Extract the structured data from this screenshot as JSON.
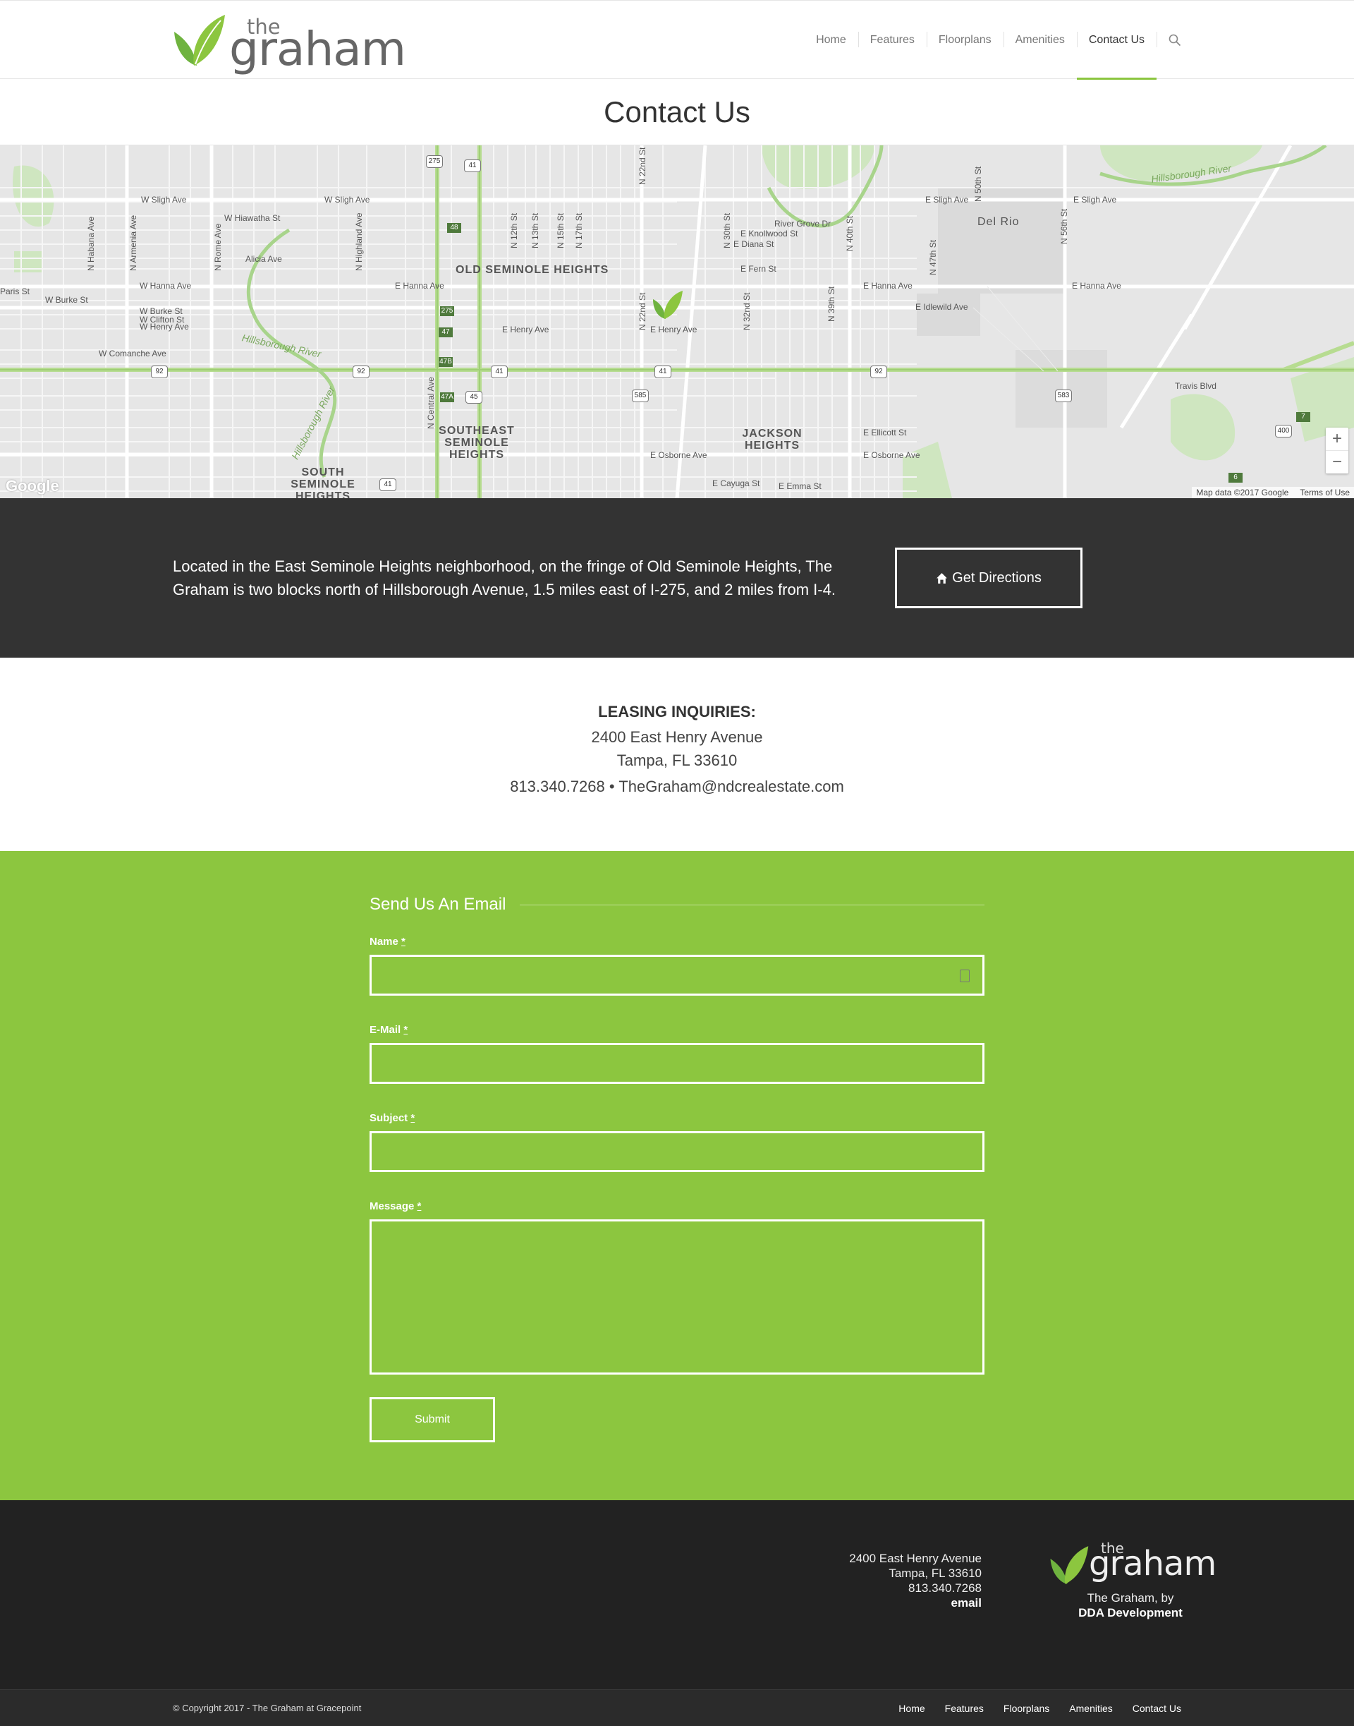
{
  "brand": {
    "the": "the",
    "name": "graham"
  },
  "nav": {
    "items": [
      "Home",
      "Features",
      "Floorplans",
      "Amenities",
      "Contact Us"
    ],
    "active": "Contact Us"
  },
  "page_title": "Contact Us",
  "map": {
    "neighborhoods": [
      "OLD SEMINOLE HEIGHTS",
      "SOUTHEAST SEMINOLE HEIGHTS",
      "JACKSON HEIGHTS",
      "SOUTH SEMINOLE HEIGHTS",
      "Del Rio"
    ],
    "streets": [
      "W Sligh Ave",
      "E Sligh Ave",
      "W Hiawatha St",
      "E Hanna Ave",
      "W Hanna Ave",
      "E Henry Ave",
      "W Henry Ave",
      "W Comanche Ave",
      "E Osborne Ave",
      "E Fern St",
      "E Idlewild Ave",
      "Travis Blvd",
      "River Grove Dr",
      "E Knollwood St",
      "E Diana St",
      "E Cayuga St",
      "E Emma St",
      "E Ellicott St",
      "W Burke St",
      "W Clifton St",
      "Alicia Ave",
      "Paris St"
    ],
    "vertical_streets": [
      "N 22nd St",
      "N 15th St",
      "N 17th St",
      "N 13th St",
      "N 12th St",
      "N 30th St",
      "N 40th St",
      "N 56th St",
      "N 47th St",
      "N 50th St",
      "N 39th St",
      "N 32nd St",
      "N Rome Ave",
      "N Armenia Ave",
      "N Habana Ave",
      "N Highland Ave",
      "N Central Ave"
    ],
    "rivers": [
      "Hillsborough River",
      "Hillsborough River",
      "Hillsborough River"
    ],
    "shields": [
      "275",
      "41",
      "92",
      "92",
      "41",
      "41",
      "585",
      "41",
      "92",
      "583",
      "400",
      "45"
    ],
    "green_shields": [
      "48",
      "275",
      "47",
      "47B",
      "47A",
      "7",
      "6"
    ],
    "zoom_in": "+",
    "zoom_out": "−",
    "google": "Google",
    "attribution": "Map data ©2017 Google",
    "terms": "Terms of Use"
  },
  "intro": {
    "text": "Located in the East Seminole Heights neighborhood, on the fringe of Old Seminole Heights, The Graham is two blocks north of Hillsborough Avenue, 1.5 miles east of I-275, and 2 miles from I-4.",
    "button_label": "Get Directions",
    "button_icon": "home-icon"
  },
  "leasing": {
    "heading": "LEASING INQUIRIES:",
    "address1": "2400 East Henry Avenue",
    "address2": "Tampa, FL 33610",
    "phone": "813.340.7268",
    "separator": "•",
    "email": "TheGraham@ndcrealestate.com"
  },
  "form": {
    "title": "Send Us An Email",
    "fields": [
      {
        "label": "Name",
        "required": "*"
      },
      {
        "label": "E-Mail",
        "required": "*"
      },
      {
        "label": "Subject",
        "required": "*"
      },
      {
        "label": "Message",
        "required": "*"
      }
    ],
    "submit": "Submit"
  },
  "footer": {
    "address1": "2400 East Henry Avenue",
    "address2": "Tampa, FL 33610",
    "phone": "813.340.7268",
    "email": "email",
    "tagline": "The Graham, by",
    "developer": "DDA Development",
    "copyright": "© Copyright 2017 - The Graham at Gracepoint",
    "nav": [
      "Home",
      "Features",
      "Floorplans",
      "Amenities",
      "Contact Us"
    ]
  },
  "colors": {
    "accent": "#8cc63f",
    "dark": "#333333",
    "footer": "#222222"
  }
}
